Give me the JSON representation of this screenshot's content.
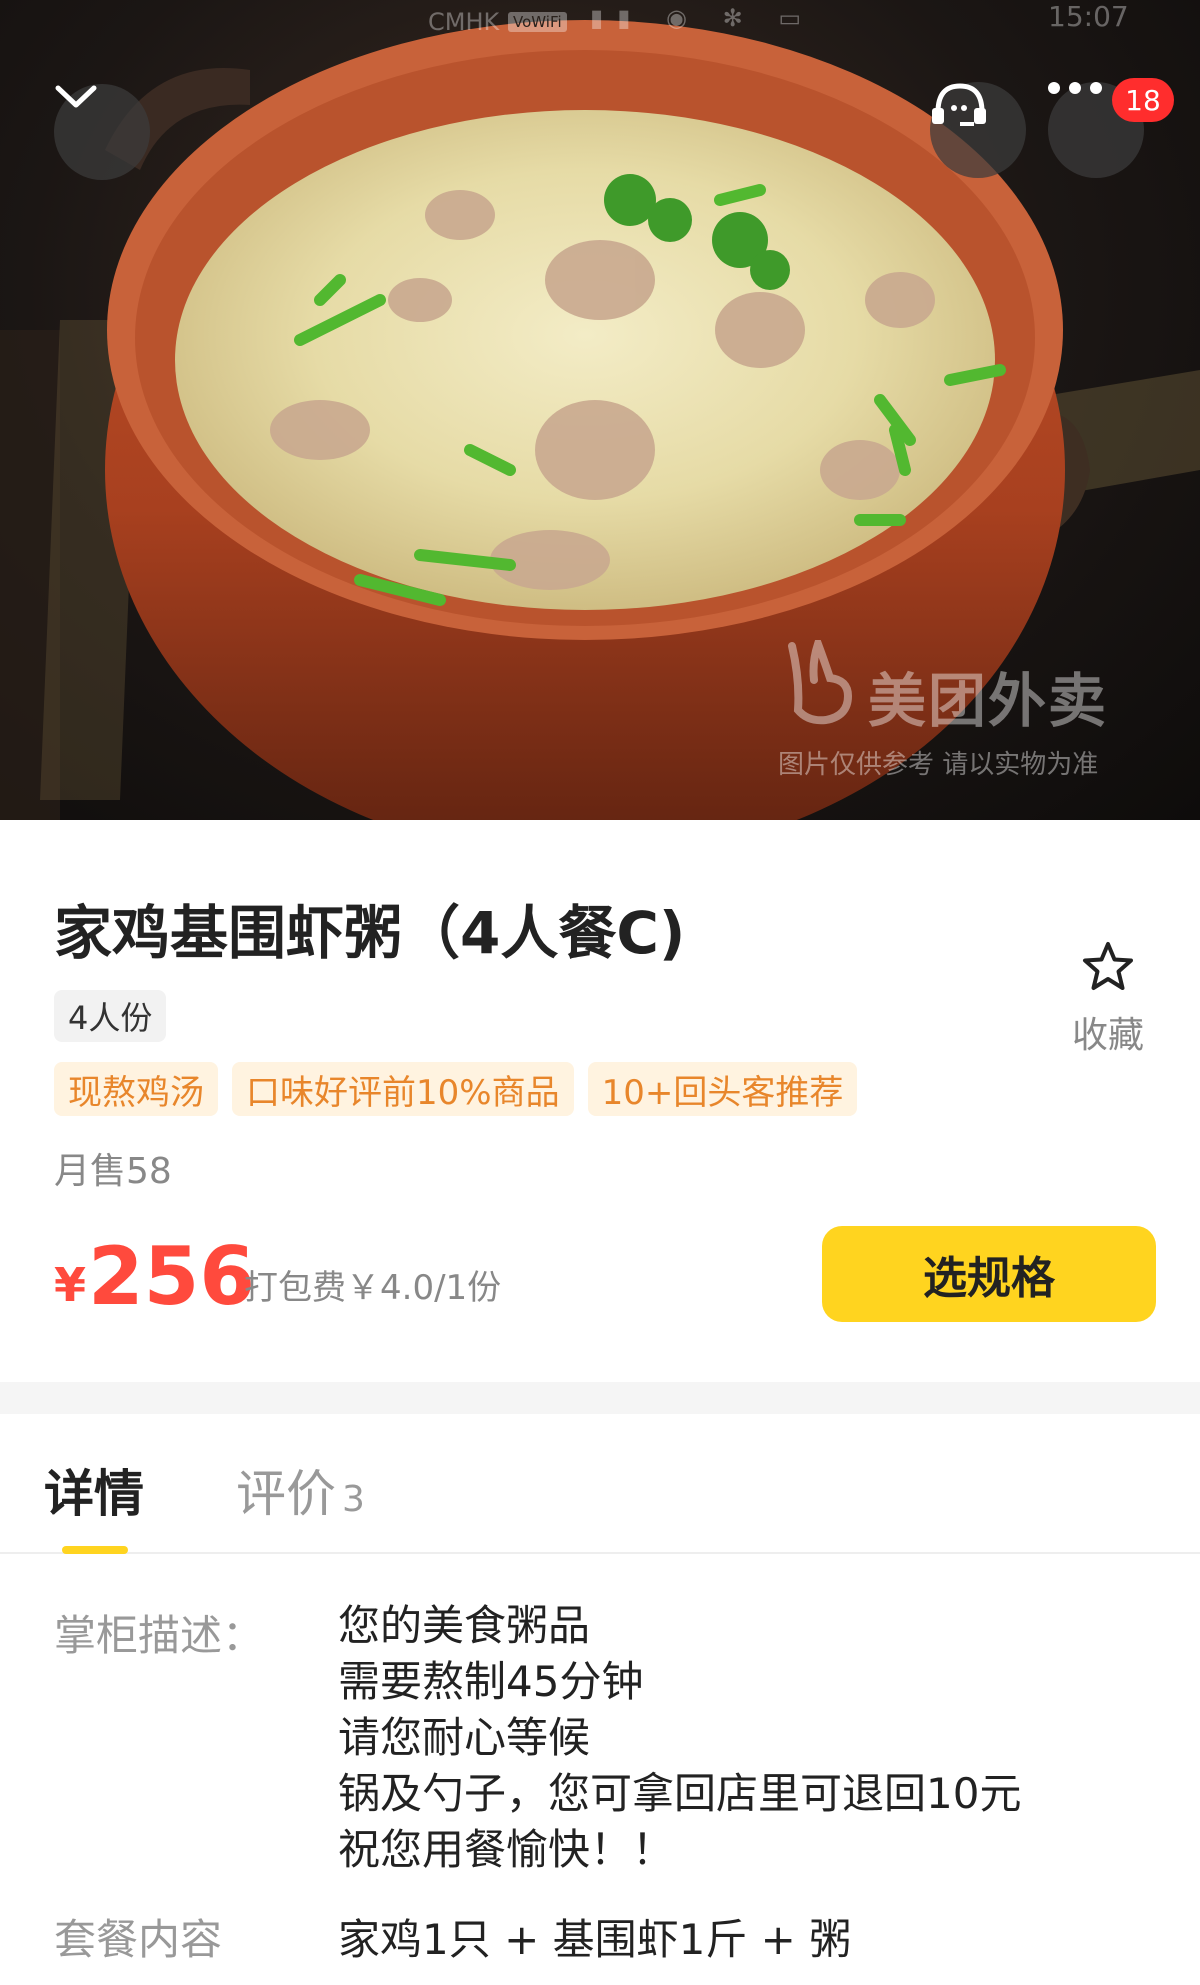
{
  "status_bar": {
    "carrier": "CMHK",
    "vowifi": "VoWiFi",
    "time": "15:07"
  },
  "header": {
    "back_icon": "chevron-down-icon",
    "service_icon": "customer-service-icon",
    "more_icon": "more-dots-icon",
    "message_badge": "18"
  },
  "watermark": {
    "brand": "美团外卖",
    "note": "图片仅供参考 请以实物为准"
  },
  "product": {
    "title": "家鸡基围虾粥（4人餐C)",
    "portion": "4人份",
    "tags": [
      "现熬鸡汤",
      "口味好评前10%商品",
      "10+回头客推荐"
    ],
    "monthly_sales": "月售58",
    "favorite_label": "收藏",
    "price_symbol": "¥",
    "price": "256",
    "packaging_fee": "打包费￥4.0/1份",
    "select_spec_label": "选规格"
  },
  "tabs": {
    "detail": "详情",
    "review": "评价",
    "review_count": "3"
  },
  "details": {
    "description_label": "掌柜描述：",
    "description_lines": [
      "您的美食粥品",
      "需要熬制45分钟",
      "请您耐心等候",
      "锅及勺子，您可拿回店里可退回10元",
      "祝您用餐愉快！！"
    ],
    "combo_label": "套餐内容",
    "combo_value": "家鸡1只 + 基围虾1斤 + 粥"
  },
  "colors": {
    "accent_yellow": "#ffd41f",
    "price_red": "#ff4a3d",
    "tag_orange": "#e8862b",
    "tag_bg": "#fff3e0",
    "badge_red": "#ff2d2d"
  }
}
